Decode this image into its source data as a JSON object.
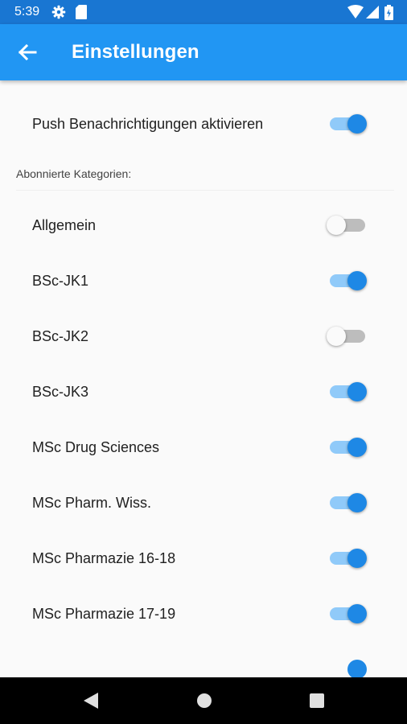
{
  "status_bar": {
    "time": "5:39",
    "left_icons": [
      "gear-icon",
      "sd-card-icon"
    ],
    "right_icons": [
      "wifi-icon",
      "cell-signal-icon",
      "battery-icon"
    ]
  },
  "app_bar": {
    "title": "Einstellungen",
    "back_icon": "arrow-left-icon",
    "color": "#2196f3"
  },
  "push_setting": {
    "label": "Push Benachrichtigungen aktivieren",
    "enabled": true
  },
  "categories_header": "Abonnierte Kategorien:",
  "categories": [
    {
      "label": "Allgemein",
      "enabled": false
    },
    {
      "label": "BSc-JK1",
      "enabled": true
    },
    {
      "label": "BSc-JK2",
      "enabled": false
    },
    {
      "label": "BSc-JK3",
      "enabled": true
    },
    {
      "label": "MSc Drug Sciences",
      "enabled": true
    },
    {
      "label": "MSc Pharm. Wiss.",
      "enabled": true
    },
    {
      "label": "MSc Pharmazie 16-18",
      "enabled": true
    },
    {
      "label": "MSc Pharmazie 17-19",
      "enabled": true
    }
  ],
  "nav_bar": {
    "buttons": [
      "back-triangle-icon",
      "home-circle-icon",
      "recents-square-icon"
    ]
  },
  "colors": {
    "accent": "#1e88e5",
    "accent_track": "#90caf9",
    "status_bar": "#1976d2",
    "off_track": "#bdbdbd"
  }
}
